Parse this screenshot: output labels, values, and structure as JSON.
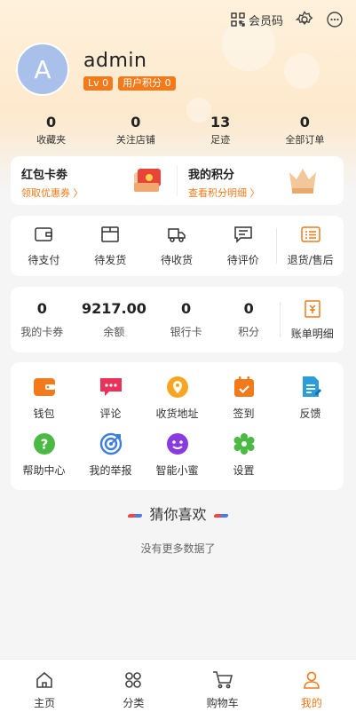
{
  "header": {
    "member_code_label": "会员码",
    "avatar_letter": "A",
    "username": "admin",
    "level_badge": "Lv 0",
    "points_badge": "用户积分 0"
  },
  "stats": [
    {
      "value": "0",
      "label": "收藏夹"
    },
    {
      "value": "0",
      "label": "关注店铺"
    },
    {
      "value": "13",
      "label": "足迹"
    },
    {
      "value": "0",
      "label": "全部订单"
    }
  ],
  "promo": {
    "coupon_title": "红包卡劵",
    "coupon_sub": "领取优惠券 〉",
    "points_title": "我的积分",
    "points_sub": "查看积分明细 〉"
  },
  "orders": [
    {
      "label": "待支付",
      "icon": "wallet-icon"
    },
    {
      "label": "待发货",
      "icon": "box-icon"
    },
    {
      "label": "待收货",
      "icon": "truck-icon"
    },
    {
      "label": "待评价",
      "icon": "comment-icon"
    },
    {
      "label": "退货/售后",
      "icon": "return-list-icon"
    }
  ],
  "wallet": [
    {
      "value": "0",
      "label": "我的卡券"
    },
    {
      "value": "9217.00",
      "label": "余额"
    },
    {
      "value": "0",
      "label": "银行卡"
    },
    {
      "value": "0",
      "label": "积分"
    }
  ],
  "wallet_bill_label": "账单明细",
  "services": [
    {
      "label": "钱包",
      "icon": "purse-icon",
      "color": "#f27a1a"
    },
    {
      "label": "评论",
      "icon": "chat-icon",
      "color": "#e8325a"
    },
    {
      "label": "收货地址",
      "icon": "location-icon",
      "color": "#f5a623"
    },
    {
      "label": "签到",
      "icon": "calendar-icon",
      "color": "#f27a1a"
    },
    {
      "label": "反馈",
      "icon": "feedback-icon",
      "color": "#2d9cdb"
    },
    {
      "label": "帮助中心",
      "icon": "help-icon",
      "color": "#4cb944"
    },
    {
      "label": "我的举报",
      "icon": "target-icon",
      "color": "#3b7de0"
    },
    {
      "label": "智能小蜜",
      "icon": "robot-icon",
      "color": "#8a3be0"
    },
    {
      "label": "设置",
      "icon": "gear-icon",
      "color": "#4cb944"
    }
  ],
  "guess_title": "猜你喜欢",
  "no_more_text": "没有更多数据了",
  "tabs": [
    {
      "label": "主页",
      "icon": "home-icon"
    },
    {
      "label": "分类",
      "icon": "category-icon"
    },
    {
      "label": "购物车",
      "icon": "cart-icon"
    },
    {
      "label": "我的",
      "icon": "user-icon"
    }
  ],
  "colors": {
    "accent": "#f27a1a",
    "header_bg": "#fde9cd",
    "avatar": "#a9c0ea"
  }
}
